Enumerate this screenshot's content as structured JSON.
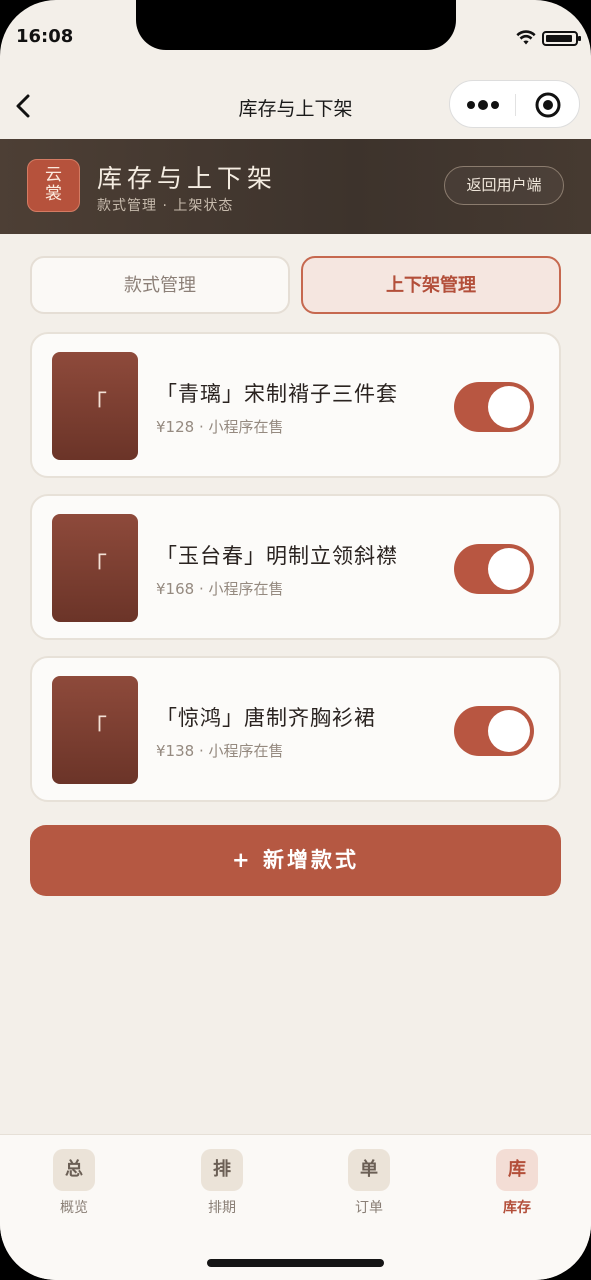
{
  "status_bar": {
    "time": "16:08"
  },
  "nav": {
    "title": "库存与上下架"
  },
  "header": {
    "logo_top": "云",
    "logo_bottom": "裳",
    "title": "库存与上下架",
    "subtitle": "款式管理 · 上架状态",
    "return_label": "返回用户端"
  },
  "tabs": [
    {
      "label": "款式管理",
      "active": false
    },
    {
      "label": "上下架管理",
      "active": true
    }
  ],
  "products": [
    {
      "thumb_char": "「",
      "name": "「青璃」宋制褙子三件套",
      "meta": "¥128 · 小程序在售",
      "on_shelf": true
    },
    {
      "thumb_char": "「",
      "name": "「玉台春」明制立领斜襟",
      "meta": "¥168 · 小程序在售",
      "on_shelf": true
    },
    {
      "thumb_char": "「",
      "name": "「惊鸿」唐制齐胸衫裙",
      "meta": "¥138 · 小程序在售",
      "on_shelf": true
    }
  ],
  "add_button": {
    "label": "+ 新增款式"
  },
  "tabbar": [
    {
      "icon": "总",
      "label": "概览",
      "active": false
    },
    {
      "icon": "排",
      "label": "排期",
      "active": false
    },
    {
      "icon": "单",
      "label": "订单",
      "active": false
    },
    {
      "icon": "库",
      "label": "库存",
      "active": true
    }
  ],
  "colors": {
    "accent": "#b55842",
    "background": "#f3efe9",
    "banner": "#3d332c"
  }
}
